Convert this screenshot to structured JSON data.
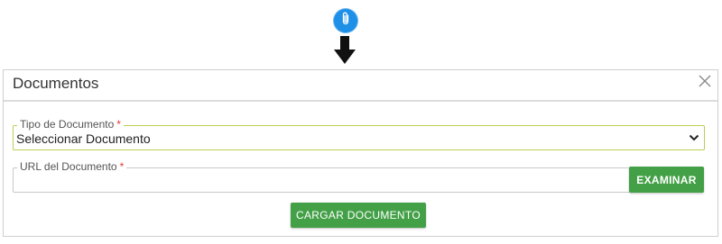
{
  "attach": {
    "icon": "paperclip-icon"
  },
  "arrow": {
    "icon": "arrow-down-icon"
  },
  "modal": {
    "title": "Documentos",
    "close_icon": "close-icon"
  },
  "form": {
    "tipo": {
      "label": "Tipo de Documento",
      "required_mark": "*",
      "value": "Seleccionar Documento"
    },
    "url": {
      "label": "URL del Documento",
      "required_mark": "*",
      "value": "",
      "browse_label": "EXAMINAR"
    },
    "submit_label": "CARGAR DOCUMENTO"
  },
  "colors": {
    "primary_blue": "#1e90e8",
    "button_green": "#43a047",
    "required_red": "#e53935",
    "focus_border": "#b9cf58"
  }
}
